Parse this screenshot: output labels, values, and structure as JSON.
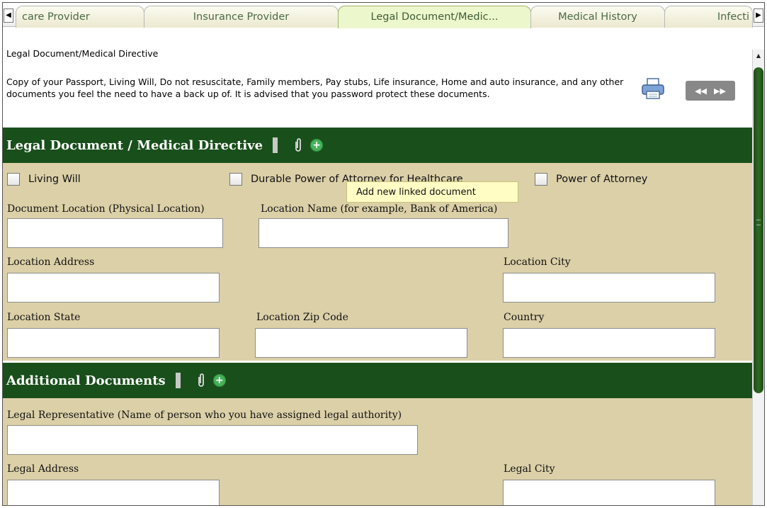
{
  "tabs": [
    {
      "label": "care Provider"
    },
    {
      "label": "Insurance Provider"
    },
    {
      "label": "Legal Document/Medic..."
    },
    {
      "label": "Medical History"
    },
    {
      "label": "Infecti"
    }
  ],
  "page_heading": "Legal Document/Medical Directive",
  "description": "Copy of your Passport, Living Will, Do not resuscitate, Family members, Pay stubs, Life insurance, Home and auto insurance, and any other documents you feel the need to have a back up of. It is advised that you password protect these documents.",
  "section1": {
    "title": "Legal Document / Medical Directive",
    "checkboxes": [
      "Living Will",
      "Durable Power of Attorney for Healthcare",
      "Power of Attorney"
    ],
    "labels": {
      "doc_location": "Document Location (Physical Location)",
      "location_name": "Location Name (for example, Bank of America)",
      "location_address": "Location Address",
      "location_city": "Location City",
      "location_state": "Location State",
      "location_zip": "Location Zip Code",
      "country": "Country"
    }
  },
  "tooltip": "Add new linked document",
  "section2": {
    "title": "Additional Documents",
    "labels": {
      "legal_rep": "Legal Representative (Name of person who you have assigned legal authority)",
      "legal_address": "Legal Address",
      "legal_city": "Legal City"
    }
  },
  "colors": {
    "header_green": "#194f1b",
    "form_bg": "#dcd0a8",
    "active_tab": "#edf7cc"
  }
}
